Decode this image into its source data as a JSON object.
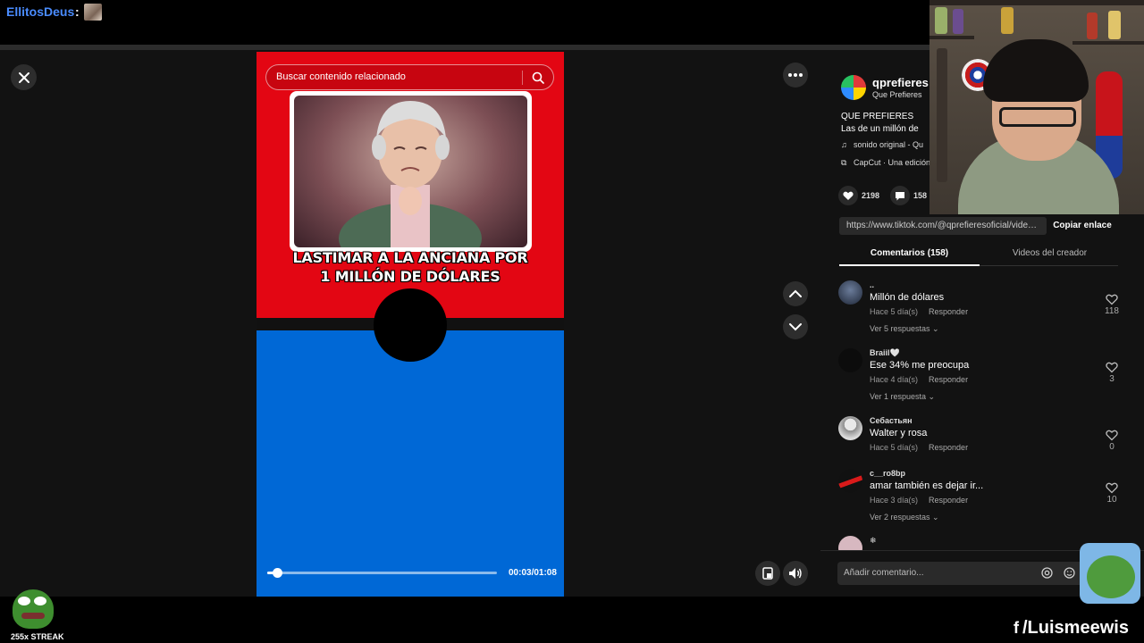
{
  "chat": {
    "username": "EllitosDeus",
    "separator": ":"
  },
  "video": {
    "search_placeholder": "Buscar contenido relacionado",
    "overlay_line1": "LASTIMAR A LA ANCIANA POR",
    "overlay_line2": "1 MILLÓN DE DÓLARES",
    "time": "00:03/01:08",
    "progress": 0.044,
    "colors": {
      "top": "#e30613",
      "bottom": "#0068d6"
    }
  },
  "author": {
    "name": "qprefieres",
    "nickname": "Que Prefieres",
    "description": "QUE PREFIERES Las de un millón de dóla",
    "sound": "sonido original - Qu",
    "capcut": "CapCut · Una edición"
  },
  "stats": {
    "likes": "2198",
    "comments": "158"
  },
  "link": {
    "url": "https://www.tiktok.com/@qprefieresoficial/video/...",
    "copy_label": "Copiar enlace"
  },
  "tabs": [
    {
      "label": "Comentarios (158)",
      "active": true
    },
    {
      "label": "Videos del creador",
      "active": false
    }
  ],
  "comments": [
    {
      "user": "..",
      "text": "Millón de dólares",
      "time": "Hace 5 día(s)",
      "reply": "Responder",
      "replies": "Ver 5 respuestas",
      "likes": "118"
    },
    {
      "user": "Braiil🤍",
      "text": "Ese 34% me preocupa",
      "time": "Hace 4 día(s)",
      "reply": "Responder",
      "replies": "Ver 1 respuesta",
      "likes": "3"
    },
    {
      "user": "Себастьян",
      "text": "Walter y rosa",
      "time": "Hace 5 día(s)",
      "reply": "Responder",
      "replies": "",
      "likes": "0"
    },
    {
      "user": "c__ro8bp",
      "text": "amar también es dejar ir...",
      "time": "Hace 3 día(s)",
      "reply": "Responder",
      "replies": "Ver 2 respuestas",
      "likes": "10"
    },
    {
      "user": "❄",
      "text": "",
      "time": "",
      "reply": "",
      "replies": "",
      "likes": ""
    }
  ],
  "comment_input": {
    "placeholder": "Añadir comentario..."
  },
  "overlay": {
    "streak": "255x STREAK",
    "social": "/Luismeewis"
  }
}
